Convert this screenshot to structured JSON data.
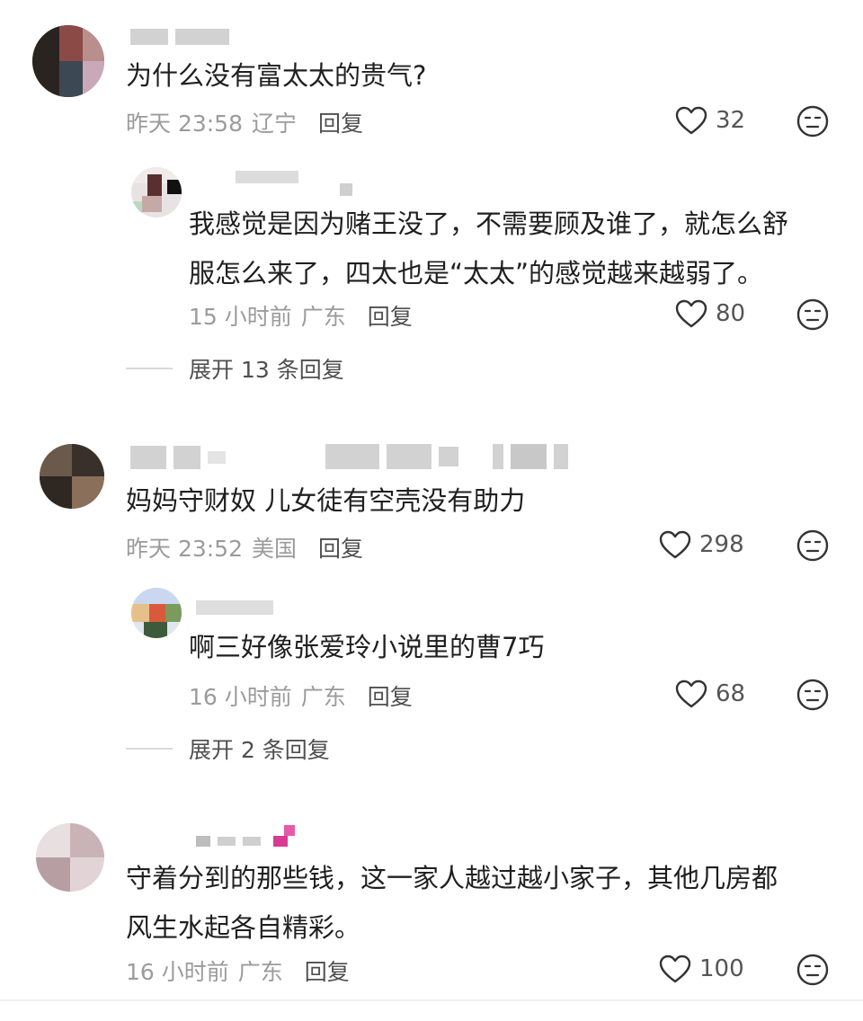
{
  "comments": [
    {
      "text": [
        "为什么没有富太太的贵气?"
      ],
      "time": "昨天 23:58",
      "location": "辽宁",
      "reply": "回复",
      "likes": "32",
      "replies": [
        {
          "text": [
            "我感觉是因为赌王没了，不需要顾及谁了，就怎么舒",
            "服怎么来了，四太也是“太太”的感觉越来越弱了。"
          ],
          "time": "15 小时前",
          "location": "广东",
          "reply": "回复",
          "likes": "80"
        }
      ],
      "expand": "展开 13 条回复"
    },
    {
      "text": [
        "妈妈守财奴 儿女徒有空壳没有助力"
      ],
      "time": "昨天 23:52",
      "location": "美国",
      "reply": "回复",
      "likes": "298",
      "replies": [
        {
          "text": [
            "啊三好像张爱玲小说里的曹7巧"
          ],
          "time": "16 小时前",
          "location": "广东",
          "reply": "回复",
          "likes": "68"
        }
      ],
      "expand": "展开 2 条回复"
    },
    {
      "text": [
        "守着分到的那些钱，这一家人越过越小家子，其他几房都",
        "风生水起各自精彩。"
      ],
      "time": "16 小时前",
      "location": "广东",
      "reply": "回复",
      "likes": "100"
    }
  ],
  "icons": {
    "like": "heart-outline-icon",
    "dislike": "neutral-face-icon"
  }
}
